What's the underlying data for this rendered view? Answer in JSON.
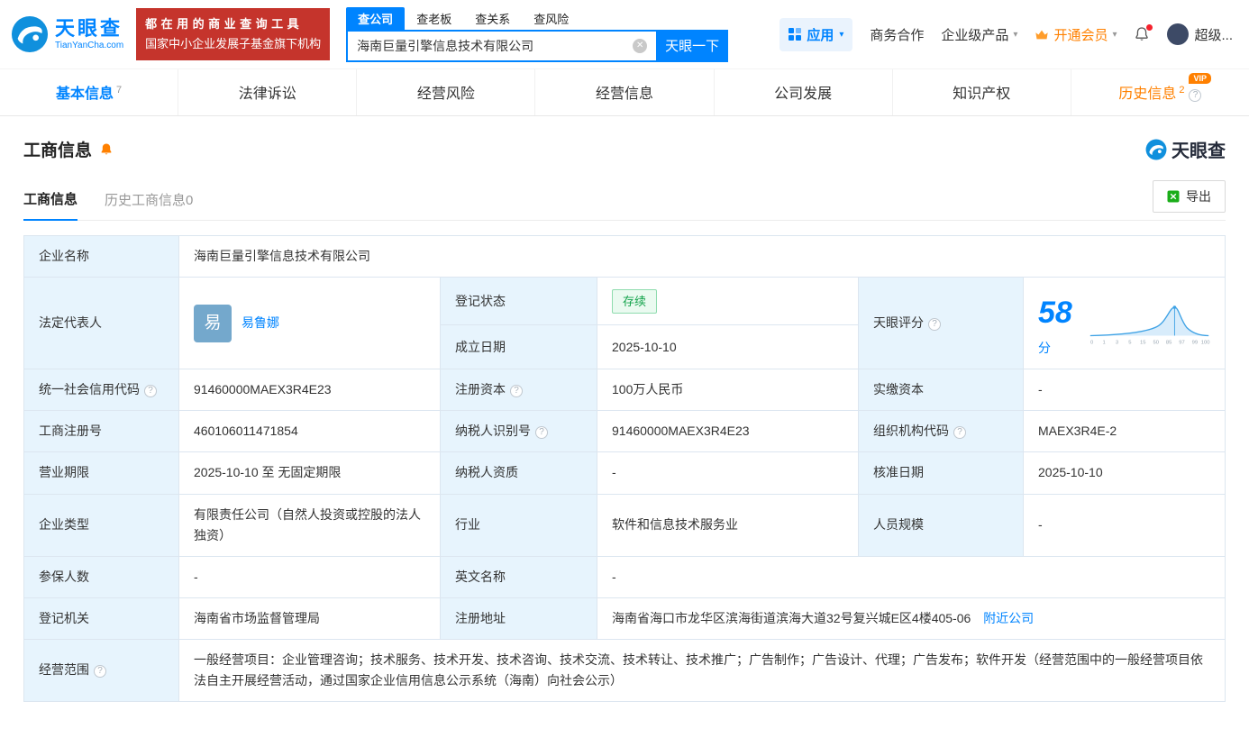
{
  "brand": {
    "cn": "天眼查",
    "en": "TianYanCha.com"
  },
  "promo": {
    "line1": "都在用的商业查询工具",
    "line2": "国家中小企业发展子基金旗下机构"
  },
  "search": {
    "tabs": [
      "查公司",
      "查老板",
      "查关系",
      "查风险"
    ],
    "value": "海南巨量引擎信息技术有限公司",
    "button": "天眼一下"
  },
  "topnav": {
    "apps": "应用",
    "biz": "商务合作",
    "enterprise": "企业级产品",
    "vip": "开通会员",
    "user": "超级..."
  },
  "icons": {
    "caret": "▾",
    "question": "?",
    "clear": "✕"
  },
  "tabs": {
    "basic": "基本信息",
    "basic_badge": "7",
    "legal": "法律诉讼",
    "risk": "经营风险",
    "operation": "经营信息",
    "development": "公司发展",
    "ip": "知识产权",
    "history": "历史信息",
    "history_badge": "2",
    "history_vip": "VIP"
  },
  "section": {
    "title": "工商信息",
    "subtab_active": "工商信息",
    "subtab_history": "历史工商信息0",
    "export": "导出",
    "brand": "天眼查"
  },
  "info": {
    "company_name_label": "企业名称",
    "company_name": "海南巨量引擎信息技术有限公司",
    "legal_rep_label": "法定代表人",
    "legal_rep_avatar": "易",
    "legal_rep_name": "易鲁娜",
    "reg_status_label": "登记状态",
    "reg_status": "存续",
    "establish_label": "成立日期",
    "establish_date": "2025-10-10",
    "score_label": "天眼评分",
    "score_value": "58",
    "score_unit": "分",
    "credit_code_label": "统一社会信用代码",
    "credit_code": "91460000MAEX3R4E23",
    "reg_capital_label": "注册资本",
    "reg_capital": "100万人民币",
    "paid_capital_label": "实缴资本",
    "paid_capital": "-",
    "reg_number_label": "工商注册号",
    "reg_number": "460106011471854",
    "taxpayer_id_label": "纳税人识别号",
    "taxpayer_id": "91460000MAEX3R4E23",
    "org_code_label": "组织机构代码",
    "org_code": "MAEX3R4E-2",
    "business_term_label": "营业期限",
    "business_term": "2025-10-10 至 无固定期限",
    "taxpayer_quality_label": "纳税人资质",
    "taxpayer_quality": "-",
    "approval_date_label": "核准日期",
    "approval_date": "2025-10-10",
    "company_type_label": "企业类型",
    "company_type": "有限责任公司（自然人投资或控股的法人独资）",
    "industry_label": "行业",
    "industry": "软件和信息技术服务业",
    "staff_size_label": "人员规模",
    "staff_size": "-",
    "insured_label": "参保人数",
    "insured": "-",
    "english_name_label": "英文名称",
    "english_name": "-",
    "reg_authority_label": "登记机关",
    "reg_authority": "海南省市场监督管理局",
    "address_label": "注册地址",
    "address": "海南省海口市龙华区滨海街道滨海大道32号复兴城E区4楼405-06",
    "nearby_link": "附近公司",
    "business_scope_label": "经营范围",
    "business_scope": "一般经营项目：企业管理咨询；技术服务、技术开发、技术咨询、技术交流、技术转让、技术推广；广告制作；广告设计、代理；广告发布；软件开发（经营范围中的一般经营项目依法自主开展经营活动，通过国家企业信用信息公示系统（海南）向社会公示）"
  },
  "score_chart": {
    "type": "area",
    "x_ticks": [
      "0",
      "1",
      "3",
      "5",
      "15",
      "50",
      "85",
      "97",
      "99",
      "100"
    ],
    "score": 58
  }
}
